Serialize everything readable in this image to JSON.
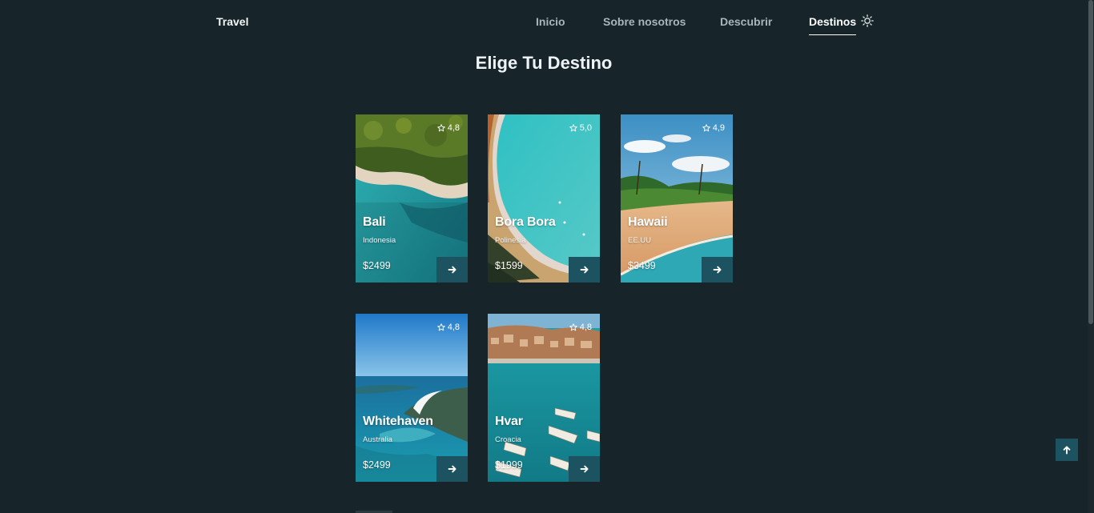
{
  "header": {
    "logo": "Travel",
    "nav": [
      {
        "label": "Inicio",
        "active": false
      },
      {
        "label": "Sobre nosotros",
        "active": false
      },
      {
        "label": "Descubrir",
        "active": false
      },
      {
        "label": "Destinos",
        "active": true
      }
    ],
    "theme_icon": "sun-icon"
  },
  "section": {
    "title": "Elige Tu Destino"
  },
  "destinations": [
    {
      "name": "Bali",
      "country": "Indonesia",
      "price": "$2499",
      "rating": "4,8",
      "scene": "jungle-beach"
    },
    {
      "name": "Bora Bora",
      "country": "Polinesia",
      "price": "$1599",
      "rating": "5,0",
      "scene": "sandbar-lagoon"
    },
    {
      "name": "Hawaii",
      "country": "EE.UU",
      "price": "$3499",
      "rating": "4,9",
      "scene": "palm-beach"
    },
    {
      "name": "Whitehaven",
      "country": "Australia",
      "price": "$2499",
      "rating": "4,8",
      "scene": "aerial-bay"
    },
    {
      "name": "Hvar",
      "country": "Croacia",
      "price": "$1999",
      "rating": "4,8",
      "scene": "harbor-boats"
    }
  ],
  "colors": {
    "background": "#17242a",
    "accent": "#1d5361",
    "nav_text": "#a9b6b9",
    "active_text": "#ffffff"
  },
  "icons": {
    "rating": "star-outline-icon",
    "card_button": "arrow-right-icon",
    "scroll_top": "arrow-up-icon"
  }
}
